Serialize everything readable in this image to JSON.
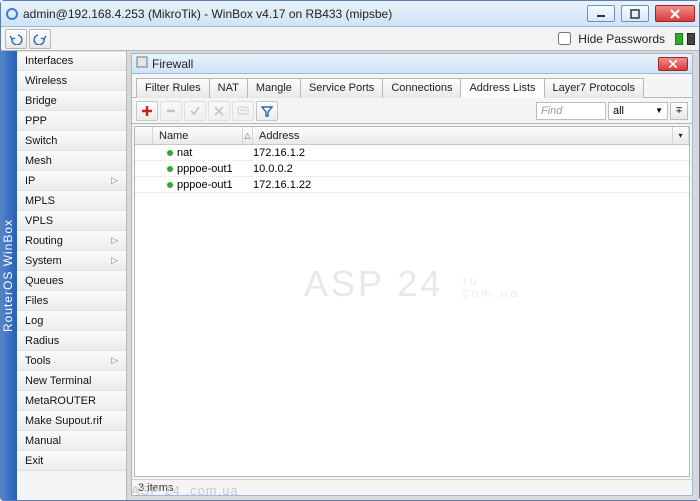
{
  "window": {
    "title": "admin@192.168.4.253 (MikroTik) - WinBox v4.17 on RB433 (mipsbe)",
    "hide_passwords_label": "Hide Passwords"
  },
  "side_rail": "RouterOS WinBox",
  "sidebar": {
    "items": [
      {
        "label": "Interfaces",
        "submenu": false
      },
      {
        "label": "Wireless",
        "submenu": false
      },
      {
        "label": "Bridge",
        "submenu": false
      },
      {
        "label": "PPP",
        "submenu": false
      },
      {
        "label": "Switch",
        "submenu": false
      },
      {
        "label": "Mesh",
        "submenu": false
      },
      {
        "label": "IP",
        "submenu": true
      },
      {
        "label": "MPLS",
        "submenu": false
      },
      {
        "label": "VPLS",
        "submenu": false
      },
      {
        "label": "Routing",
        "submenu": true
      },
      {
        "label": "System",
        "submenu": true
      },
      {
        "label": "Queues",
        "submenu": false
      },
      {
        "label": "Files",
        "submenu": false
      },
      {
        "label": "Log",
        "submenu": false
      },
      {
        "label": "Radius",
        "submenu": false
      },
      {
        "label": "Tools",
        "submenu": true
      },
      {
        "label": "New Terminal",
        "submenu": false
      },
      {
        "label": "MetaROUTER",
        "submenu": false
      },
      {
        "label": "Make Supout.rif",
        "submenu": false
      },
      {
        "label": "Manual",
        "submenu": false
      },
      {
        "label": "Exit",
        "submenu": false
      }
    ]
  },
  "firewall": {
    "title": "Firewall",
    "tabs": [
      "Filter Rules",
      "NAT",
      "Mangle",
      "Service Ports",
      "Connections",
      "Address Lists",
      "Layer7 Protocols"
    ],
    "active_tab": 5,
    "find_placeholder": "Find",
    "filter_select": "all",
    "columns": {
      "name": "Name",
      "address": "Address"
    },
    "rows": [
      {
        "name": "nat",
        "address": "172.16.1.2"
      },
      {
        "name": "pppoe-out1",
        "address": "10.0.0.2"
      },
      {
        "name": "pppoe-out1",
        "address": "172.16.1.22"
      }
    ],
    "status": "3 items"
  },
  "watermark": {
    "main": "ASP 24",
    "sub1": ".ru",
    "sub2": ".com.ua"
  },
  "footer_wm": "ASP 24 .com.ua"
}
